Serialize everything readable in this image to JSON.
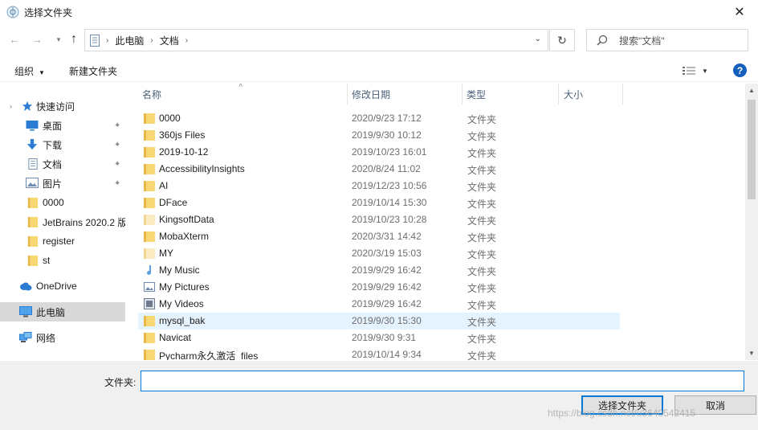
{
  "window": {
    "title": "选择文件夹",
    "close_glyph": "✕"
  },
  "nav": {
    "back_glyph": "←",
    "forward_glyph": "→",
    "up_glyph": "↑",
    "address": [
      "此电脑",
      "文档"
    ],
    "search_placeholder": "搜索\"文档\""
  },
  "toolbar": {
    "organize_label": "组织",
    "new_folder_label": "新建文件夹",
    "help_label": "?"
  },
  "sidebar": {
    "items": [
      {
        "label": "快速访问",
        "icon": "star-icon"
      },
      {
        "label": "桌面",
        "icon": "desktop-icon",
        "pinned": true
      },
      {
        "label": "下载",
        "icon": "download-icon",
        "pinned": true
      },
      {
        "label": "文档",
        "icon": "document-icon",
        "pinned": true
      },
      {
        "label": "图片",
        "icon": "picture-icon",
        "pinned": true
      },
      {
        "label": "0000",
        "icon": "folder-icon"
      },
      {
        "label": "JetBrains 2020.2 版",
        "icon": "folder-icon"
      },
      {
        "label": "register",
        "icon": "folder-icon"
      },
      {
        "label": "st",
        "icon": "folder-icon"
      },
      {
        "label": "OneDrive",
        "icon": "cloud-icon"
      },
      {
        "label": "此电脑",
        "icon": "computer-icon",
        "selected": true
      },
      {
        "label": "网络",
        "icon": "network-icon"
      }
    ]
  },
  "columns": {
    "name": "名称",
    "date": "修改日期",
    "type": "类型",
    "size": "大小"
  },
  "files": [
    {
      "name": "0000",
      "date": "2020/9/23 17:12",
      "type": "文件夹",
      "icon": "folder-icon"
    },
    {
      "name": "360js Files",
      "date": "2019/9/30 10:12",
      "type": "文件夹",
      "icon": "folder-icon"
    },
    {
      "name": "2019-10-12",
      "date": "2019/10/23 16:01",
      "type": "文件夹",
      "icon": "folder-icon"
    },
    {
      "name": "AccessibilityInsights",
      "date": "2020/8/24 11:02",
      "type": "文件夹",
      "icon": "folder-icon"
    },
    {
      "name": "AI",
      "date": "2019/12/23 10:56",
      "type": "文件夹",
      "icon": "folder-icon"
    },
    {
      "name": "DFace",
      "date": "2019/10/14 15:30",
      "type": "文件夹",
      "icon": "folder-icon"
    },
    {
      "name": "KingsoftData",
      "date": "2019/10/23 10:28",
      "type": "文件夹",
      "icon": "folder-light-icon"
    },
    {
      "name": "MobaXterm",
      "date": "2020/3/31 14:42",
      "type": "文件夹",
      "icon": "folder-icon"
    },
    {
      "name": "MY",
      "date": "2020/3/19 15:03",
      "type": "文件夹",
      "icon": "folder-light-icon"
    },
    {
      "name": "My Music",
      "date": "2019/9/29 16:42",
      "type": "文件夹",
      "icon": "music-icon"
    },
    {
      "name": "My Pictures",
      "date": "2019/9/29 16:42",
      "type": "文件夹",
      "icon": "picture-icon"
    },
    {
      "name": "My Videos",
      "date": "2019/9/29 16:42",
      "type": "文件夹",
      "icon": "video-icon"
    },
    {
      "name": "mysql_bak",
      "date": "2019/9/30 15:30",
      "type": "文件夹",
      "icon": "folder-icon",
      "selected": true
    },
    {
      "name": "Navicat",
      "date": "2019/9/30 9:31",
      "type": "文件夹",
      "icon": "folder-icon"
    },
    {
      "name": "Pycharm永久激活_files",
      "date": "2019/10/14 9:34",
      "type": "文件夹",
      "icon": "folder-icon"
    }
  ],
  "bottom": {
    "folder_label": "文件夹:",
    "folder_value": "",
    "ok_label": "选择文件夹",
    "cancel_label": "取消",
    "watermark": "https://blog.csdn.net/u3640542415"
  },
  "colors": {
    "accent": "#0078d7",
    "folder": "#f8d775",
    "folder_dark": "#e8b84a",
    "selection": "#e5f3ff"
  }
}
